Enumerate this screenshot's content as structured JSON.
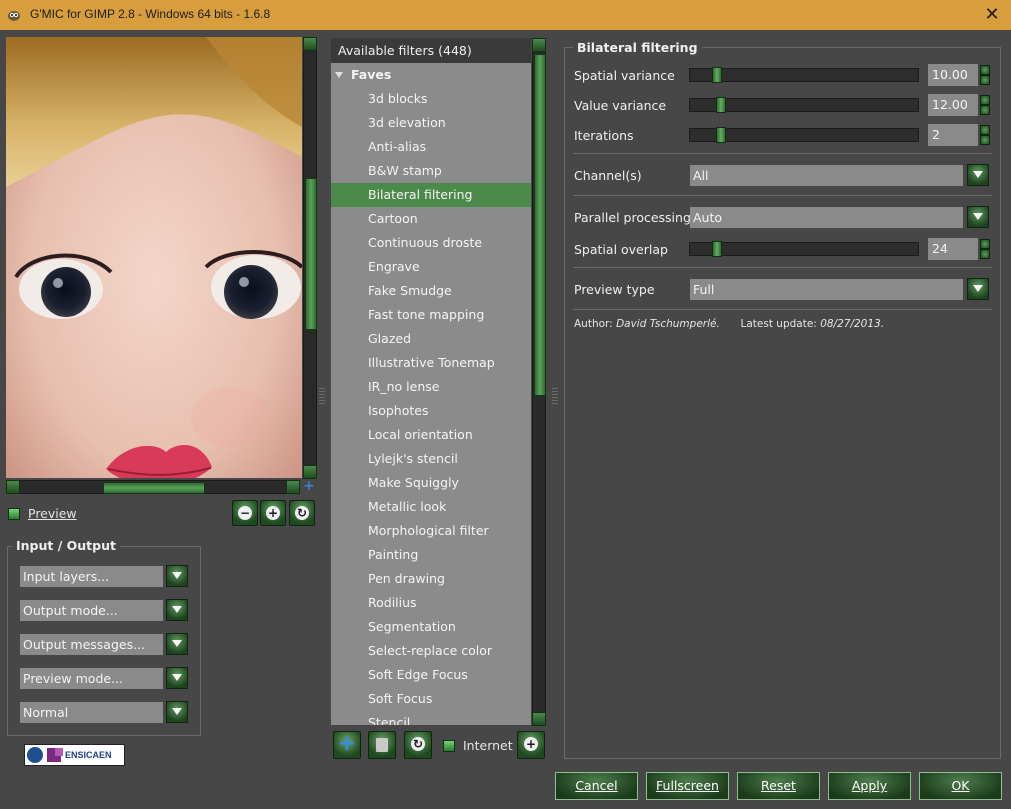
{
  "window": {
    "title": "G'MIC for GIMP 2.8 - Windows 64 bits - 1.6.8"
  },
  "preview": {
    "label": "Preview"
  },
  "io": {
    "title": "Input / Output",
    "input_layers": "Input layers...",
    "output_mode": "Output mode...",
    "output_messages": "Output messages...",
    "preview_mode": "Preview mode...",
    "blend": "Normal"
  },
  "logo": {
    "text": "ENSICAEN"
  },
  "filters": {
    "header": "Available filters (448)",
    "faves": "Faves",
    "items": [
      "3d blocks",
      "3d elevation",
      "Anti-alias",
      "B&W stamp",
      "Bilateral filtering",
      "Cartoon",
      "Continuous droste",
      "Engrave",
      "Fake Smudge",
      "Fast tone mapping",
      "Glazed",
      "Illustrative Tonemap",
      "IR_no lense",
      "Isophotes",
      "Local orientation",
      "Lylejk's stencil",
      "Make Squiggly",
      "Metallic look",
      "Morphological filter",
      "Painting",
      "Pen drawing",
      "Rodilius",
      "Segmentation",
      "Select-replace color",
      "Soft Edge Focus",
      "Soft Focus",
      "Stencil"
    ],
    "selected": "Bilateral filtering",
    "internet": "Internet"
  },
  "params": {
    "title": "Bilateral filtering",
    "spatial_variance": {
      "label": "Spatial variance",
      "value": "10.00",
      "fraction": 0.1
    },
    "value_variance": {
      "label": "Value variance",
      "value": "12.00",
      "fraction": 0.12
    },
    "iterations": {
      "label": "Iterations",
      "value": "2",
      "fraction": 0.12
    },
    "channels": {
      "label": "Channel(s)",
      "value": "All"
    },
    "parallel": {
      "label": "Parallel processing",
      "value": "Auto"
    },
    "overlap": {
      "label": "Spatial overlap",
      "value": "24",
      "fraction": 0.1
    },
    "preview_type": {
      "label": "Preview type",
      "value": "Full"
    },
    "author_label": "Author:",
    "author": "David Tschumperlé.",
    "update_label": "Latest update:",
    "update": "08/27/2013."
  },
  "buttons": {
    "cancel": "Cancel",
    "fullscreen": "Fullscreen",
    "reset": "Reset",
    "apply": "Apply",
    "ok": "OK"
  },
  "colors": {
    "title_bar": "#d89e3e",
    "accent_green": "#4c8a4c",
    "panel_bg": "#474747"
  }
}
